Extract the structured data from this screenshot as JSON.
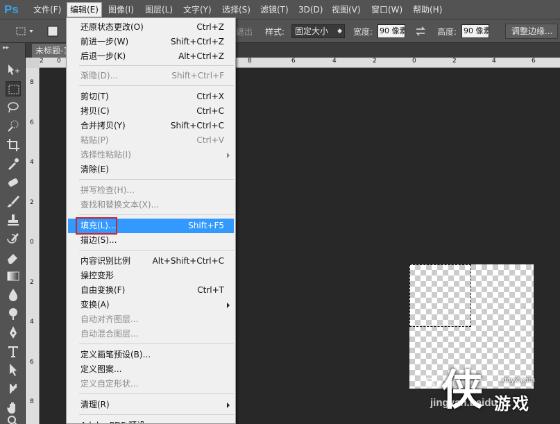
{
  "app": {
    "logo": "Ps"
  },
  "menubar": {
    "items": [
      "文件(F)",
      "编辑(E)",
      "图像(I)",
      "图层(L)",
      "文字(Y)",
      "选择(S)",
      "滤镜(T)",
      "3D(D)",
      "视图(V)",
      "窗口(W)",
      "帮助(H)"
    ],
    "active": "编辑(E)"
  },
  "options": {
    "partial_label": "遮出",
    "style_label": "样式:",
    "style_value": "固定大小",
    "width_label": "宽度:",
    "width_value": "90 像素",
    "height_label": "高度:",
    "height_value": "90 像素",
    "refine_button": "调整边缘..."
  },
  "document": {
    "tab_title": "未标题-1"
  },
  "rulers": {
    "top": [
      "2",
      "0",
      "2",
      "8",
      "6",
      "4",
      "2",
      "0",
      "2",
      "4",
      "6",
      "8"
    ],
    "left": [
      "8",
      "6",
      "4",
      "2",
      "0",
      "2",
      "4",
      "6",
      "8"
    ]
  },
  "edit_menu": {
    "groups": [
      [
        {
          "label": "还原状态更改(O)",
          "shortcut": "Ctrl+Z"
        },
        {
          "label": "前进一步(W)",
          "shortcut": "Shift+Ctrl+Z"
        },
        {
          "label": "后退一步(K)",
          "shortcut": "Alt+Ctrl+Z"
        }
      ],
      [
        {
          "label": "渐隐(D)...",
          "shortcut": "Shift+Ctrl+F",
          "disabled": true
        }
      ],
      [
        {
          "label": "剪切(T)",
          "shortcut": "Ctrl+X"
        },
        {
          "label": "拷贝(C)",
          "shortcut": "Ctrl+C"
        },
        {
          "label": "合并拷贝(Y)",
          "shortcut": "Shift+Ctrl+C"
        },
        {
          "label": "粘贴(P)",
          "shortcut": "Ctrl+V",
          "disabled": true
        },
        {
          "label": "选择性粘贴(I)",
          "shortcut": "",
          "disabled": true,
          "submenu": true
        },
        {
          "label": "清除(E)",
          "shortcut": ""
        }
      ],
      [
        {
          "label": "拼写检查(H)...",
          "shortcut": "",
          "disabled": true
        },
        {
          "label": "查找和替换文本(X)...",
          "shortcut": "",
          "disabled": true
        }
      ],
      [
        {
          "label": "填充(L)...",
          "shortcut": "Shift+F5",
          "highlighted": true
        },
        {
          "label": "描边(S)...",
          "shortcut": ""
        }
      ],
      [
        {
          "label": "内容识别比例",
          "shortcut": "Alt+Shift+Ctrl+C"
        },
        {
          "label": "操控变形",
          "shortcut": ""
        },
        {
          "label": "自由变换(F)",
          "shortcut": "Ctrl+T"
        },
        {
          "label": "变换(A)",
          "shortcut": "",
          "submenu": true
        },
        {
          "label": "自动对齐图层...",
          "shortcut": "",
          "disabled": true
        },
        {
          "label": "自动混合图层...",
          "shortcut": "",
          "disabled": true
        }
      ],
      [
        {
          "label": "定义画笔预设(B)...",
          "shortcut": ""
        },
        {
          "label": "定义图案...",
          "shortcut": ""
        },
        {
          "label": "定义自定形状...",
          "shortcut": "",
          "disabled": true
        }
      ],
      [
        {
          "label": "清理(R)",
          "shortcut": "",
          "submenu": true
        }
      ],
      [
        {
          "label": "Adobe PDF 预设...",
          "shortcut": ""
        }
      ]
    ]
  },
  "watermark": {
    "site": "xiayx.com",
    "game": "游戏",
    "logo": "侠",
    "jingyan": "jingyan.baidu",
    "baidu": "Bai"
  }
}
